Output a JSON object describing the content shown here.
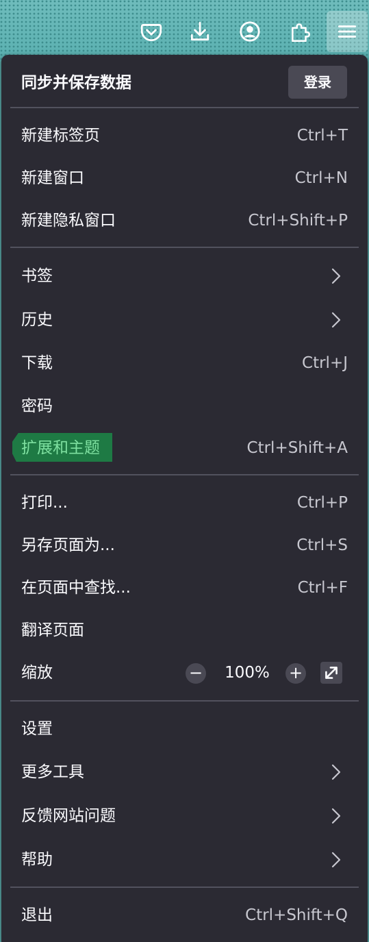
{
  "toolbar": {
    "icons": [
      "pocket-icon",
      "download-icon",
      "account-icon",
      "extensions-icon",
      "menu-icon"
    ]
  },
  "menu": {
    "sync": {
      "title": "同步并保存数据",
      "login_label": "登录"
    },
    "items": [
      {
        "label": "新建标签页",
        "shortcut": "Ctrl+T"
      },
      {
        "label": "新建窗口",
        "shortcut": "Ctrl+N"
      },
      {
        "label": "新建隐私窗口",
        "shortcut": "Ctrl+Shift+P"
      },
      {
        "label": "书签"
      },
      {
        "label": "历史"
      },
      {
        "label": "下载",
        "shortcut": "Ctrl+J"
      },
      {
        "label": "密码"
      },
      {
        "label": "扩展和主题",
        "shortcut": "Ctrl+Shift+A"
      },
      {
        "label": "打印...",
        "shortcut": "Ctrl+P"
      },
      {
        "label": "另存页面为...",
        "shortcut": "Ctrl+S"
      },
      {
        "label": "在页面中查找...",
        "shortcut": "Ctrl+F"
      },
      {
        "label": "翻译页面"
      },
      {
        "label": "缩放",
        "zoom_value": "100%"
      },
      {
        "label": "设置"
      },
      {
        "label": "更多工具"
      },
      {
        "label": "反馈网站问题"
      },
      {
        "label": "帮助"
      },
      {
        "label": "退出",
        "shortcut": "Ctrl+Shift+Q"
      }
    ]
  },
  "colors": {
    "panel_bg": "#2b2a33",
    "text": "#fbfbfe",
    "highlight": "#1e7a44"
  }
}
